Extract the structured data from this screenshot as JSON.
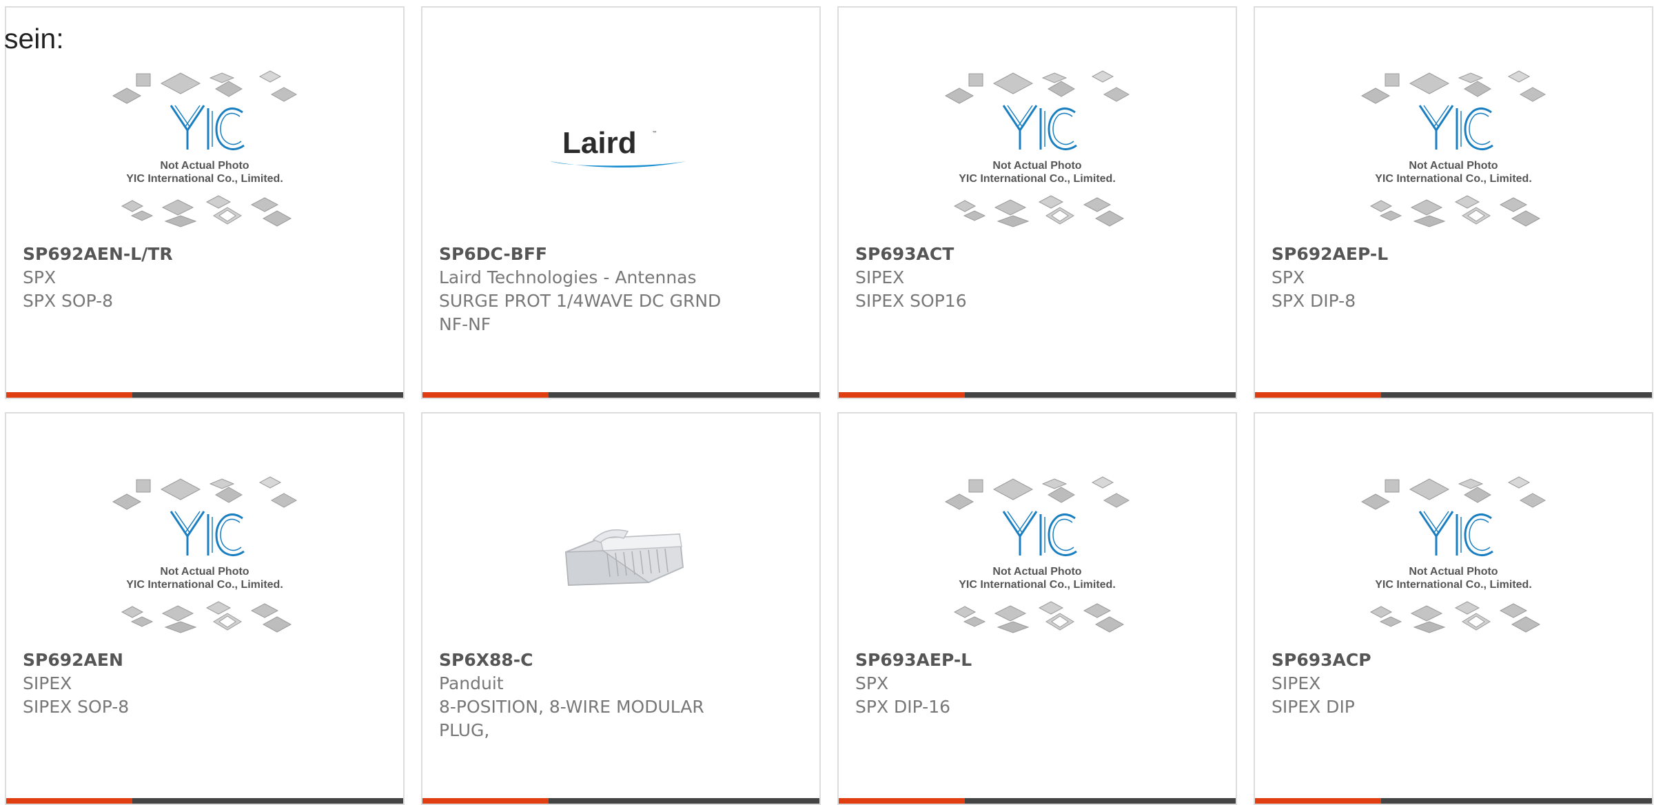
{
  "intro_text": "sein:",
  "colors": {
    "accent_bar": "#e03e10",
    "dark_bar": "#444444",
    "card_border": "#dddddd",
    "yic_blue": "#1a7fc1",
    "laird_blue": "#1a8fd0"
  },
  "placeholder_image": {
    "line1": "Not Actual Photo",
    "line2": "YIC International Co., Limited.",
    "logo": "YIC"
  },
  "laird_logo_text": "Laird",
  "products": [
    {
      "part_number": "SP692AEN-L/TR",
      "manufacturer": "SPX",
      "description": "SPX SOP-8",
      "image": "yic-placeholder"
    },
    {
      "part_number": "SP6DC-BFF",
      "manufacturer": "Laird Technologies - Antennas",
      "description": "SURGE PROT 1/4WAVE DC GRND NF-NF",
      "image": "laird-logo"
    },
    {
      "part_number": "SP693ACT",
      "manufacturer": "SIPEX",
      "description": "SIPEX SOP16",
      "image": "yic-placeholder"
    },
    {
      "part_number": "SP692AEP-L",
      "manufacturer": "SPX",
      "description": "SPX DIP-8",
      "image": "yic-placeholder"
    },
    {
      "part_number": "SP692AEN",
      "manufacturer": "SIPEX",
      "description": "SIPEX SOP-8",
      "image": "yic-placeholder"
    },
    {
      "part_number": "SP6X88-C",
      "manufacturer": "Panduit",
      "description": "8-POSITION, 8-WIRE MODULAR PLUG,",
      "image": "modular-plug-photo"
    },
    {
      "part_number": "SP693AEP-L",
      "manufacturer": "SPX",
      "description": "SPX DIP-16",
      "image": "yic-placeholder"
    },
    {
      "part_number": "SP693ACP",
      "manufacturer": "SIPEX",
      "description": "SIPEX DIP",
      "image": "yic-placeholder"
    }
  ]
}
